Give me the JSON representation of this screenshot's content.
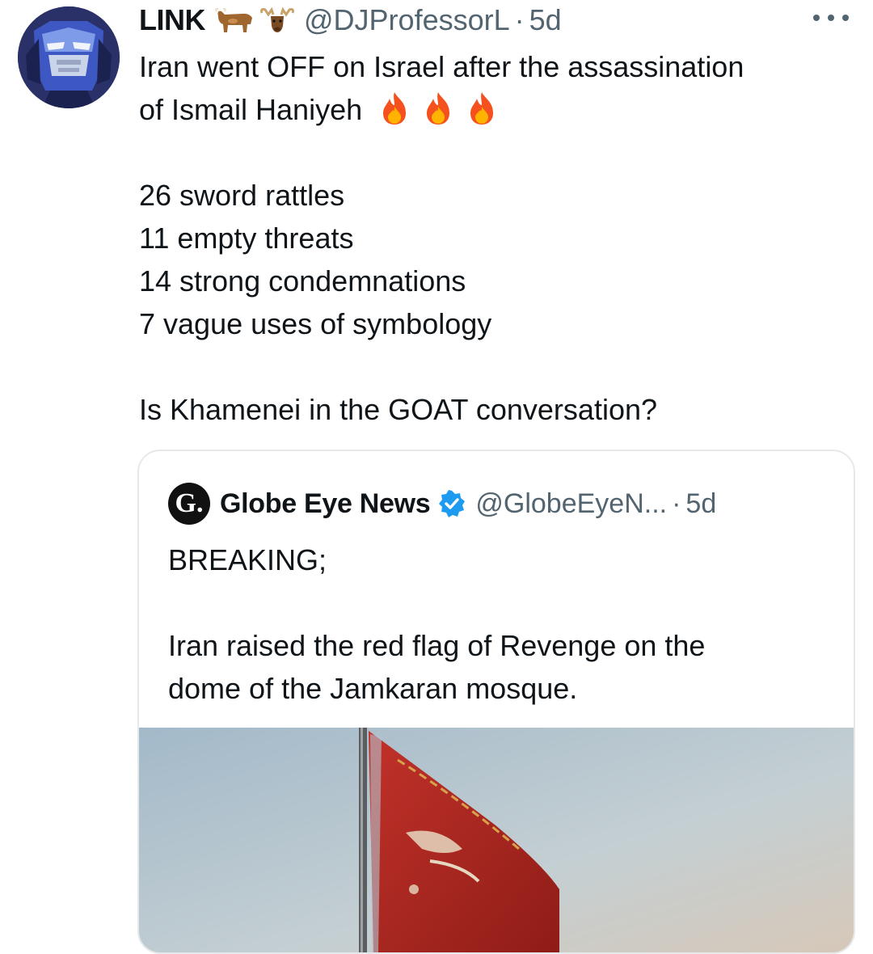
{
  "author": {
    "display_name": "LINK",
    "handle": "@DJProfessorL",
    "separator": "·",
    "age": "5d",
    "name_emojis": [
      "ox-emoji",
      "moose-emoji"
    ]
  },
  "tweet": {
    "lines": [
      "Iran went OFF on Israel after the assassination",
      "of Ismail Haniyeh",
      "",
      "26 sword rattles",
      "11 empty threats",
      "14 strong condemnations",
      "7 vague uses of symbology",
      "",
      "Is Khamenei in the GOAT conversation?"
    ],
    "trailing_emojis": [
      "fire-emoji",
      "fire-emoji",
      "fire-emoji"
    ]
  },
  "quoted": {
    "logo_letter": "G.",
    "display_name": "Globe Eye News",
    "verified": true,
    "handle": "@GlobeEyeN...",
    "separator": "·",
    "age": "5d",
    "lines": [
      "BREAKING;",
      "",
      "Iran raised the red flag of Revenge on the",
      "dome of the Jamkaran mosque."
    ]
  },
  "colors": {
    "text": "#0f1419",
    "muted": "#536471",
    "border": "#e6e9eb",
    "verified": "#1d9bf0",
    "flag_red": "#b3261e"
  }
}
